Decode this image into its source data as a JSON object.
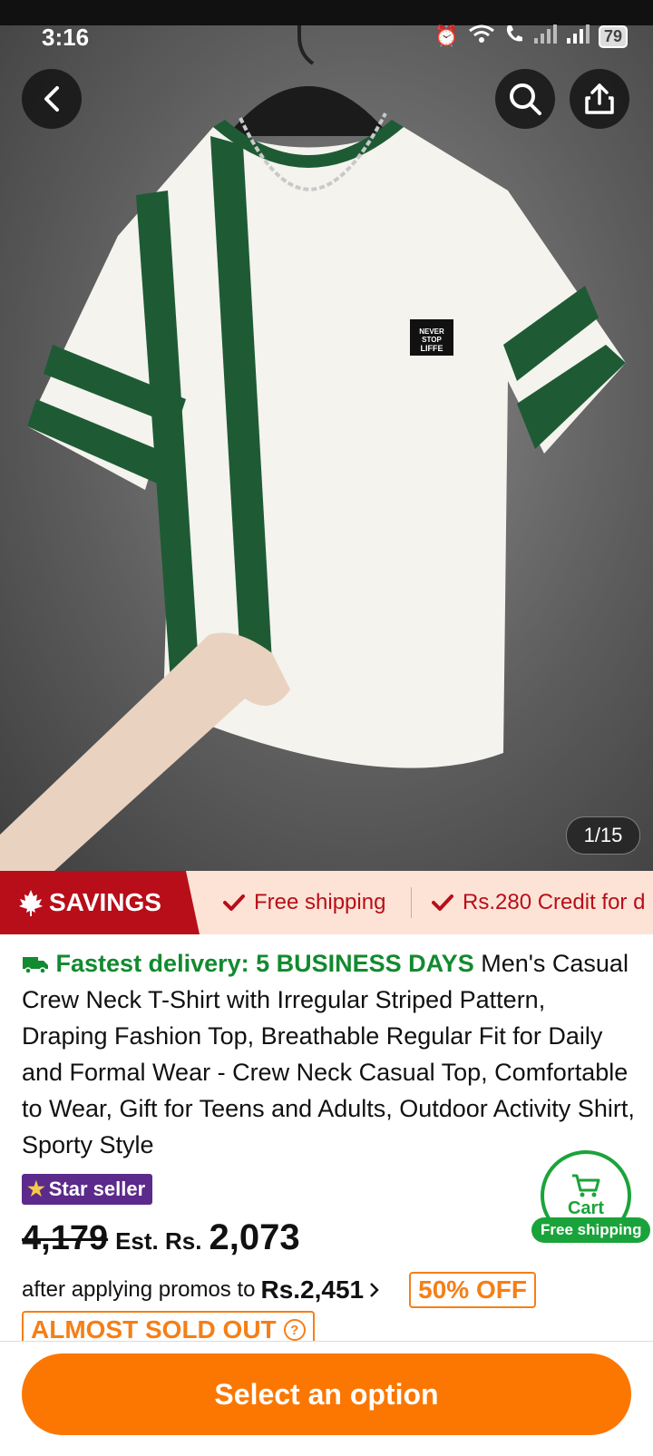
{
  "status_bar": {
    "time": "3:16",
    "battery": "79"
  },
  "gallery": {
    "counter": "1/15",
    "patch_text": "NEVER STOP LIFFE"
  },
  "savings": {
    "label": "SAVINGS",
    "perks": [
      "Free shipping",
      "Rs.280 Credit for d"
    ]
  },
  "product": {
    "delivery": "Fastest delivery: 5 BUSINESS DAYS",
    "title": " Men's Casual Crew Neck T-Shirt with Irregular Striped Pattern, Draping Fashion Top, Breathable Regular Fit for Daily and Formal Wear - Crew Neck Casual Top, Comfortable to Wear, Gift for Teens and Adults, Outdoor Activity Shirt, Sporty Style",
    "star_seller": "Star seller",
    "original_price": "4,179",
    "est_label": "Est. Rs.",
    "est_price": "2,073",
    "promo_text": "after applying promos to",
    "promo_price": "Rs.2,451",
    "discount": "50% OFF",
    "stock_status": "ALMOST SOLD OUT"
  },
  "cart": {
    "label": "Cart",
    "badge": "Free shipping"
  },
  "cta": {
    "label": "Select an option"
  },
  "colors": {
    "accent": "#fb7701",
    "savings_red": "#b80e1a",
    "delivery_green": "#128a2f",
    "star_purple": "#5b2a8a"
  }
}
